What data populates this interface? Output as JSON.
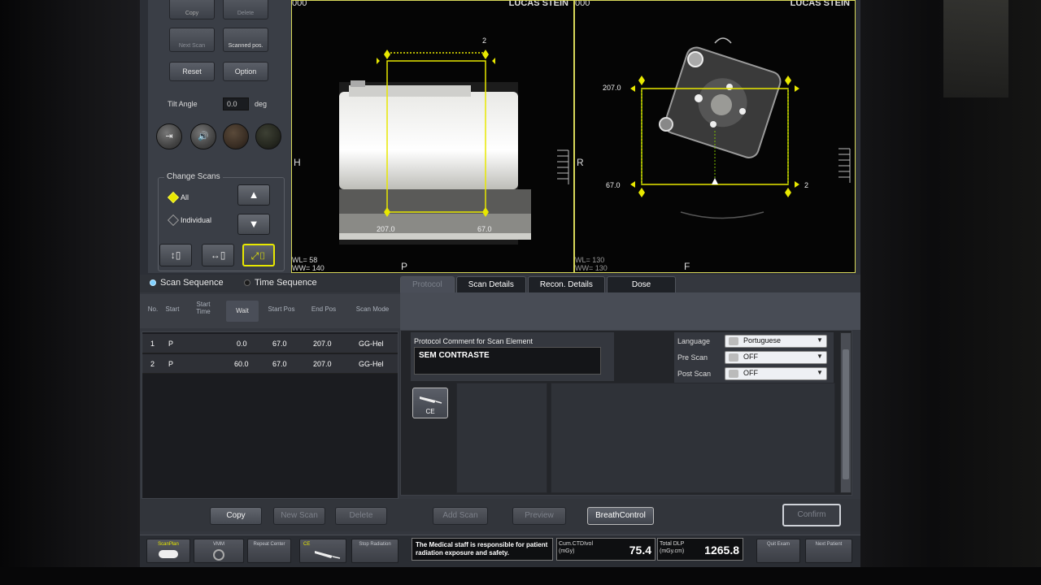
{
  "colors": {
    "accent_yellow": "#e8e800",
    "screen_bg": "#2c2f36",
    "viewport_bg": "#050505"
  },
  "control_panel": {
    "buttons": {
      "copy": "Copy",
      "delete": "Delete",
      "next_scan": "Next Scan",
      "scanned_pos": "Scanned pos.",
      "reset": "Reset",
      "option": "Option"
    },
    "tilt_label": "Tilt Angle",
    "tilt_value": "0.0",
    "tilt_unit": "deg",
    "change_scans": {
      "title": "Change Scans",
      "all": "All",
      "individual": "Individual"
    },
    "round_icons": [
      "table-move-icon",
      "sound-icon",
      "dark-orb-icon",
      "dark-orb-icon"
    ]
  },
  "viewport_left": {
    "number": "000",
    "patient": "LUCAS STEIN",
    "top_marker": "2",
    "range_start": "207.0",
    "range_end": "67.0",
    "side_letter": "H",
    "bottom_letter": "P",
    "wl": "WL= 58",
    "ww": "WW= 140"
  },
  "viewport_right": {
    "number": "000",
    "patient": "LUCAS STEIN",
    "top_value": "207.0",
    "bottom_value": "67.0",
    "right_marker": "2",
    "side_letter": "R",
    "bottom_letter": "F",
    "wl": "WL= 130",
    "ww": "WW= 130"
  },
  "sequence": {
    "scan_sequence": "Scan Sequence",
    "time_sequence": "Time Sequence",
    "columns": [
      "No.",
      "Start",
      "Start Time",
      "Wait",
      "Start Pos",
      "End Pos",
      "Scan Mode"
    ],
    "rows": [
      {
        "no": "1",
        "start": "P",
        "wait": "0.0",
        "start_pos": "67.0",
        "end_pos": "207.0",
        "mode": "GG-Hel"
      },
      {
        "no": "2",
        "start": "P",
        "wait": "60.0",
        "start_pos": "67.0",
        "end_pos": "207.0",
        "mode": "GG-Hel"
      }
    ]
  },
  "tabs": [
    "Protocol",
    "Scan Details",
    "Recon. Details",
    "Dose"
  ],
  "details": {
    "protocol_comment_label": "Protocol Comment for Scan Element",
    "protocol_comment_value": "SEM CONTRASTE",
    "language_label": "Language",
    "language_value": "Portuguese",
    "pre_scan_label": "Pre Scan",
    "pre_scan_value": "OFF",
    "post_scan_label": "Post Scan",
    "post_scan_value": "OFF",
    "ce_label": "CE"
  },
  "actions": {
    "copy": "Copy",
    "new_scan": "New Scan",
    "delete": "Delete",
    "add_scan": "Add Scan",
    "preview": "Preview",
    "breath_control": "BreathControl",
    "confirm": "Confirm"
  },
  "status_bar": {
    "scanplan": "ScanPlan",
    "vmm": "VMM",
    "repeat_center": "Repeat Center",
    "ce": "CE",
    "stop_radiation": "Stop Radiation",
    "warning": "The Medical staff is responsible for patient radiation exposure and safety.",
    "ctdi_label": "Cum.CTDIvol (mGy)",
    "ctdi_value": "75.4",
    "dlp_label": "Total DLP (mGy.cm)",
    "dlp_value": "1265.8",
    "quit_exam": "Quit Exam",
    "next_patient": "Next Patient"
  }
}
